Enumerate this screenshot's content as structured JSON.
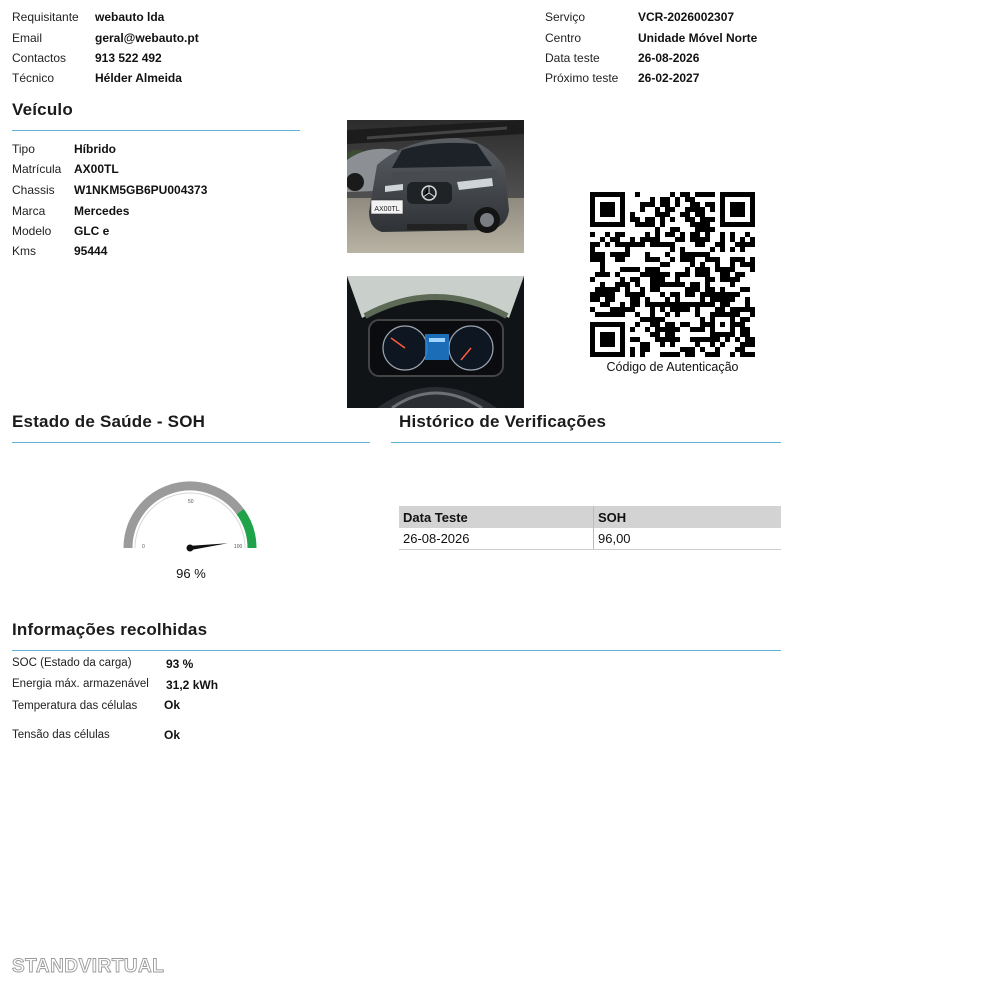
{
  "header": {
    "left": [
      {
        "label": "Requisitante",
        "value": "webauto lda"
      },
      {
        "label": "Email",
        "value": "geral@webauto.pt"
      },
      {
        "label": "Contactos",
        "value": "913 522 492"
      },
      {
        "label": "Técnico",
        "value": "Hélder Almeida"
      }
    ],
    "right": [
      {
        "label": "Serviço",
        "value": "VCR-2026002307"
      },
      {
        "label": "Centro",
        "value": "Unidade Móvel Norte"
      },
      {
        "label": "Data teste",
        "value": "26-08-2026"
      },
      {
        "label": "Próximo teste",
        "value": "26-02-2027"
      }
    ]
  },
  "vehicle": {
    "title": "Veículo",
    "fields": [
      {
        "label": "Tipo",
        "value": "Híbrido"
      },
      {
        "label": "Matrícula",
        "value": "AX00TL"
      },
      {
        "label": "Chassis",
        "value": "W1NKM5GB6PU004373"
      },
      {
        "label": "Marca",
        "value": "Mercedes"
      },
      {
        "label": "Modelo",
        "value": "GLC e"
      },
      {
        "label": "Kms",
        "value": "95444"
      }
    ],
    "plate_text": "AX00TL"
  },
  "qr": {
    "caption": "Código de Autenticação"
  },
  "soh": {
    "title": "Estado de Saúde - SOH",
    "value": 96,
    "display": "96 %",
    "gauge": {
      "min_label": "0",
      "mid_label": "50",
      "max_label": "100",
      "green_from": 80,
      "color_gray": "#9b9b9b",
      "color_green": "#1fa34a"
    }
  },
  "history": {
    "title": "Histórico de Verificações",
    "columns": [
      "Data Teste",
      "SOH"
    ],
    "rows": [
      [
        "26-08-2026",
        "96,00"
      ]
    ]
  },
  "info": {
    "title": "Informações recolhidas",
    "fields": [
      {
        "label": "SOC (Estado da carga)",
        "value": "93 %"
      },
      {
        "label": "Energia máx. armazenável",
        "value": "31,2 kWh"
      },
      {
        "label": "Temperatura das células",
        "value": "Ok"
      },
      {
        "label": "Tensão das células",
        "value": "Ok"
      }
    ]
  },
  "watermark": "STANDVIRTUAL",
  "colors": {
    "accent_rule": "#5fb4d6",
    "table_header": "#d3d3d3"
  }
}
